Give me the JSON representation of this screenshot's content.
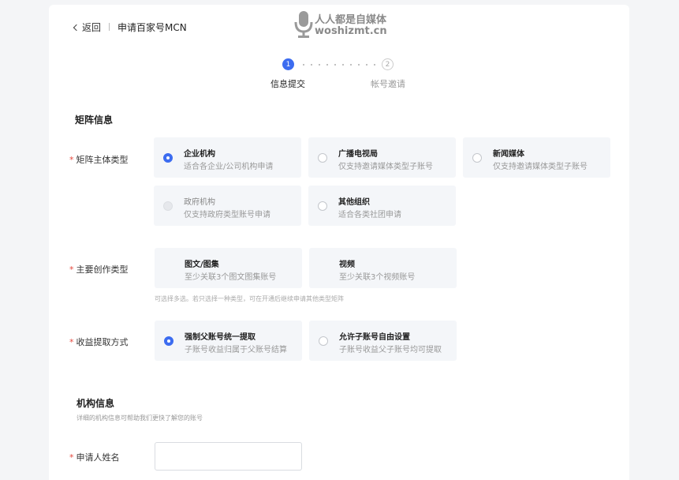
{
  "header": {
    "back_label": "返回",
    "title": "申请百家号MCN"
  },
  "watermark": {
    "cn": "人人都是自媒体",
    "url": "woshizmt.cn"
  },
  "steps": [
    {
      "num": "1",
      "label": "信息提交",
      "active": true
    },
    {
      "num": "2",
      "label": "帐号邀请",
      "active": false
    }
  ],
  "matrix": {
    "section_title": "矩阵信息",
    "subject": {
      "label": "矩阵主体类型",
      "options": [
        {
          "title": "企业机构",
          "desc": "适合各企业/公司机构申请",
          "state": "checked"
        },
        {
          "title": "广播电视局",
          "desc": "仅支持邀请媒体类型子账号",
          "state": "unchecked"
        },
        {
          "title": "新闻媒体",
          "desc": "仅支持邀请媒体类型子账号",
          "state": "unchecked"
        },
        {
          "title": "政府机构",
          "desc": "仅支持政府类型账号申请",
          "state": "disabled"
        },
        {
          "title": "其他组织",
          "desc": "适合各类社团申请",
          "state": "unchecked"
        }
      ]
    },
    "creation": {
      "label": "主要创作类型",
      "options": [
        {
          "title": "图文/图集",
          "desc": "至少关联3个图文图集账号"
        },
        {
          "title": "视频",
          "desc": "至少关联3个视频账号"
        }
      ],
      "hint": "可选择多选。若只选择一种类型，可在开通后继续申请其他类型矩阵"
    },
    "revenue": {
      "label": "收益提取方式",
      "options": [
        {
          "title": "强制父账号统一提取",
          "desc": "子账号收益归属于父账号结算",
          "state": "checked"
        },
        {
          "title": "允许子账号自由设置",
          "desc": "子账号收益父子账号均可提取",
          "state": "unchecked"
        }
      ]
    }
  },
  "org": {
    "section_title": "机构信息",
    "section_desc": "详细的机构信息可帮助我们更快了解您的账号",
    "applicant": {
      "label": "申请人姓名",
      "value": "",
      "placeholder": ""
    }
  }
}
